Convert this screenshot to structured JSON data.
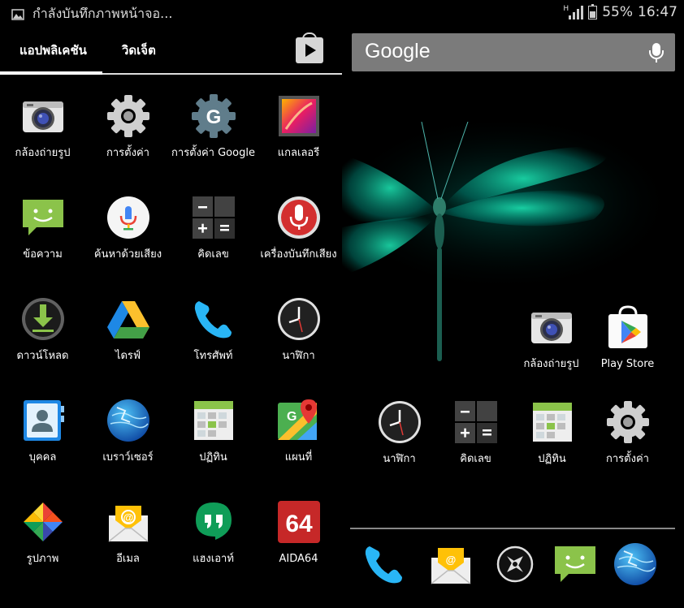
{
  "status": {
    "notification": "กำลังบันทึกภาพหน้าจอ...",
    "network": "H",
    "battery": "55%",
    "time": "16:47"
  },
  "drawer": {
    "tabs": [
      "แอปพลิเคชัน",
      "วิดเจ็ต"
    ],
    "apps": [
      {
        "label": "กล้องถ่ายรูป",
        "icon": "camera-icon"
      },
      {
        "label": "การตั้งค่า",
        "icon": "settings-gear-icon"
      },
      {
        "label": "การตั้งค่า Google",
        "icon": "google-settings-icon"
      },
      {
        "label": "แกลเลอรี",
        "icon": "gallery-icon"
      },
      {
        "label": "ข้อความ",
        "icon": "messaging-icon"
      },
      {
        "label": "ค้นหาด้วยเสียง",
        "icon": "voice-search-icon"
      },
      {
        "label": "คิดเลข",
        "icon": "calculator-icon"
      },
      {
        "label": "เครื่องบันทึกเสียง",
        "icon": "sound-recorder-icon"
      },
      {
        "label": "ดาวน์โหลด",
        "icon": "download-icon"
      },
      {
        "label": "ไดรฟ์",
        "icon": "drive-icon"
      },
      {
        "label": "โทรศัพท์",
        "icon": "phone-icon"
      },
      {
        "label": "นาฬิกา",
        "icon": "clock-icon"
      },
      {
        "label": "บุคคล",
        "icon": "contacts-icon"
      },
      {
        "label": "เบราว์เซอร์",
        "icon": "browser-globe-icon"
      },
      {
        "label": "ปฏิทิน",
        "icon": "calendar-icon"
      },
      {
        "label": "แผนที่",
        "icon": "maps-icon"
      },
      {
        "label": "รูปภาพ",
        "icon": "photos-pinwheel-icon"
      },
      {
        "label": "อีเมล",
        "icon": "email-icon"
      },
      {
        "label": "แฮงเอาท์",
        "icon": "hangouts-icon"
      },
      {
        "label": "AIDA64",
        "icon": "aida64-icon"
      }
    ]
  },
  "home": {
    "search_logo": "Google",
    "shortcuts": [
      {
        "label": "กล้องถ่ายรูป",
        "icon": "camera-icon"
      },
      {
        "label": "Play Store",
        "icon": "play-store-icon"
      },
      {
        "label": "นาฬิกา",
        "icon": "clock-icon"
      },
      {
        "label": "คิดเลข",
        "icon": "calculator-icon"
      },
      {
        "label": "ปฏิทิน",
        "icon": "calendar-icon"
      },
      {
        "label": "การตั้งค่า",
        "icon": "settings-gear-icon"
      }
    ],
    "dock": [
      {
        "icon": "phone-icon"
      },
      {
        "icon": "email-icon"
      },
      {
        "icon": "app-drawer-icon"
      },
      {
        "icon": "messaging-icon"
      },
      {
        "icon": "browser-globe-icon"
      }
    ]
  }
}
